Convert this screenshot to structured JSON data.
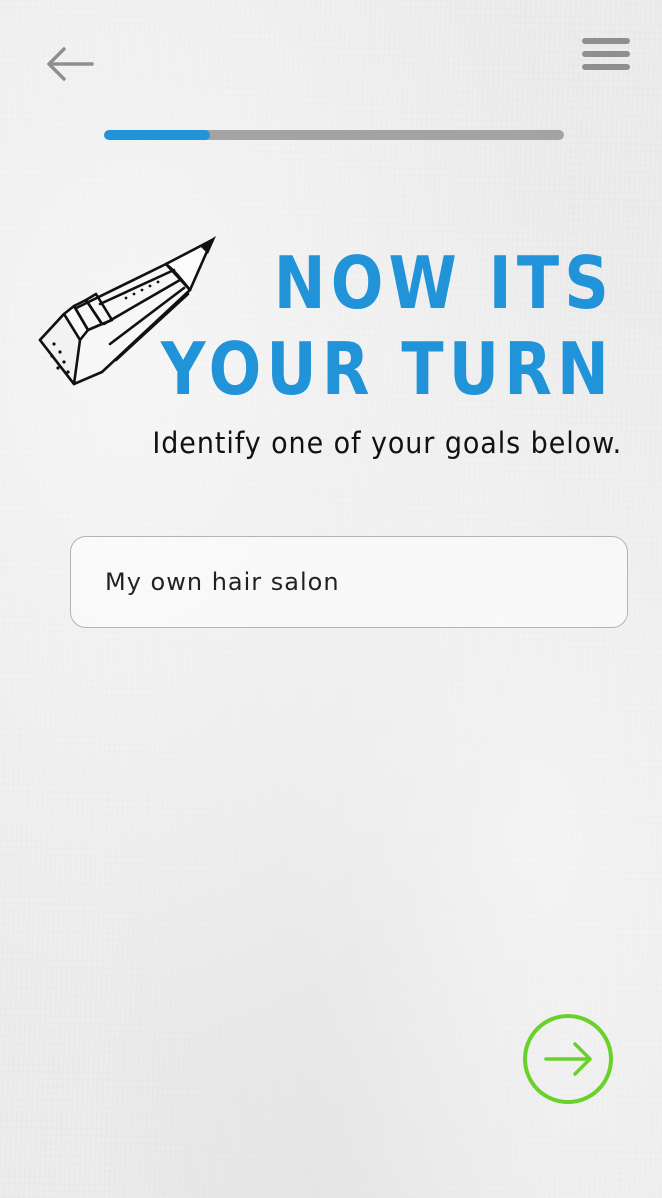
{
  "header": {
    "back_icon": "arrow-left-icon",
    "menu_icon": "hamburger-menu-icon"
  },
  "progress": {
    "fraction": 0.23,
    "fill_color": "#2193d8",
    "track_color": "#a3a3a3"
  },
  "main": {
    "illustration": "pencil-icon",
    "heading_line1": "NOW ITS",
    "heading_line2": "YOUR TURN",
    "heading_color": "#2193d8",
    "subtitle": "Identify one of your goals below.",
    "goal_input": {
      "value": "My own hair salon"
    }
  },
  "footer": {
    "next_icon": "arrow-right-circle-icon",
    "next_color": "#69d12a"
  }
}
